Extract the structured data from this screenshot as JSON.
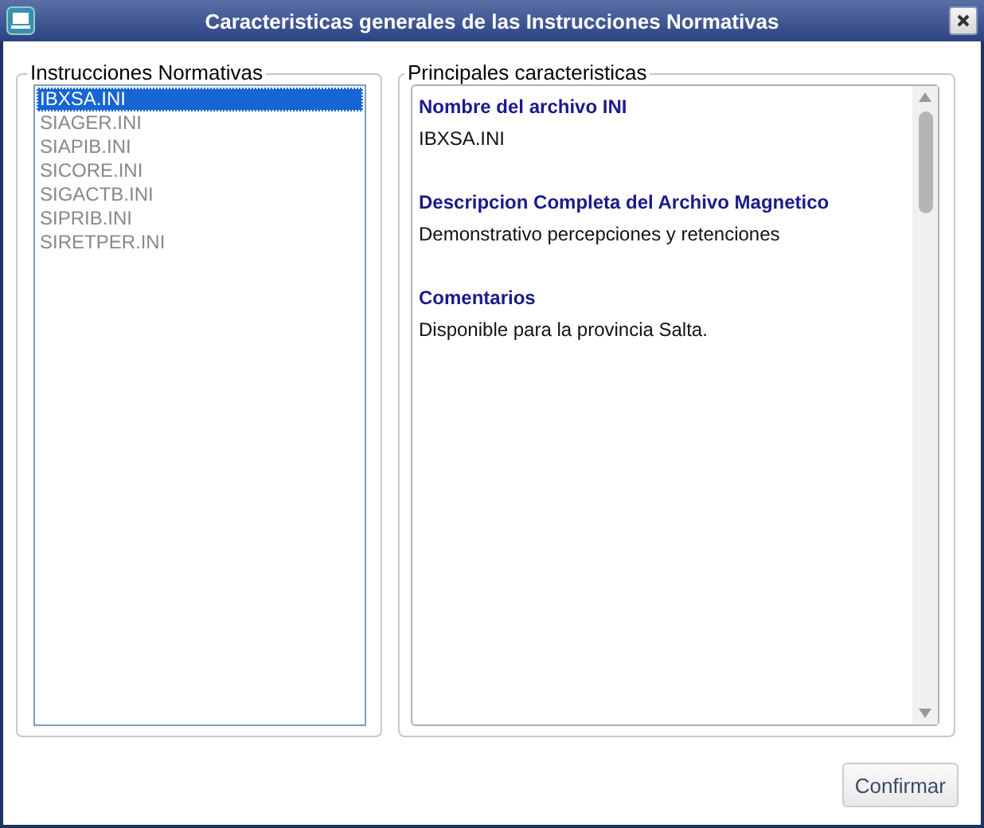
{
  "window": {
    "title": "Caracteristicas generales de las Instrucciones Normativas"
  },
  "list_panel": {
    "legend": "Instrucciones Normativas",
    "items": [
      {
        "label": "IBXSA.INI",
        "selected": true
      },
      {
        "label": "SIAGER.INI",
        "selected": false
      },
      {
        "label": "SIAPIB.INI",
        "selected": false
      },
      {
        "label": "SICORE.INI",
        "selected": false
      },
      {
        "label": "SIGACTB.INI",
        "selected": false
      },
      {
        "label": "SIPRIB.INI",
        "selected": false
      },
      {
        "label": "SIRETPER.INI",
        "selected": false
      }
    ]
  },
  "details_panel": {
    "legend": "Principales caracteristicas",
    "sections": [
      {
        "heading": "Nombre del archivo INI",
        "value": "IBXSA.INI"
      },
      {
        "heading": "Descripcion Completa del Archivo Magnetico",
        "value": "Demonstrativo percepciones y retenciones"
      },
      {
        "heading": "Comentarios",
        "value": "Disponible para la provincia Salta."
      }
    ]
  },
  "buttons": [
    "Confirmar"
  ]
}
